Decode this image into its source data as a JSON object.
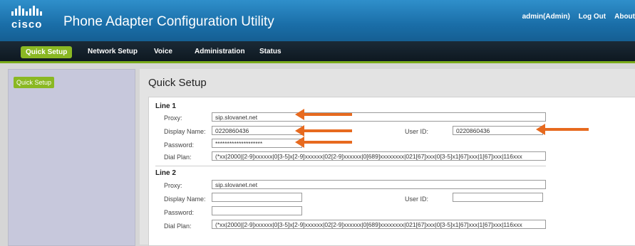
{
  "header": {
    "logo_text": "cisco",
    "title": "Phone Adapter Configuration Utility",
    "user": "admin(Admin)",
    "logout": "Log Out",
    "about": "About"
  },
  "nav": {
    "tabs": [
      {
        "label": "Quick Setup",
        "active": true
      },
      {
        "label": "Network Setup"
      },
      {
        "label": "Voice"
      },
      {
        "label": "Administration"
      },
      {
        "label": "Status"
      }
    ]
  },
  "sidebar": {
    "items": [
      {
        "label": "Quick Setup"
      }
    ]
  },
  "main": {
    "title": "Quick Setup",
    "line1": {
      "heading": "Line 1",
      "proxy_label": "Proxy:",
      "proxy_value": "sip.slovanet.net",
      "display_name_label": "Display Name:",
      "display_name_value": "0220860436",
      "user_id_label": "User ID:",
      "user_id_value": "0220860436",
      "password_label": "Password:",
      "password_value": "********************",
      "dial_plan_label": "Dial Plan:",
      "dial_plan_value": "(*xx|2000|[2-9]xxxxxx|0[3-5]x[2-9]xxxxxx|02[2-9]xxxxxx|0[689]xxxxxxxx|021[67]xxx|0[3-5]x1[67]xxx|1[67]xxx|116xxx"
    },
    "line2": {
      "heading": "Line 2",
      "proxy_label": "Proxy:",
      "proxy_value": "sip.slovanet.net",
      "display_name_label": "Display Name:",
      "display_name_value": "",
      "user_id_label": "User ID:",
      "user_id_value": "",
      "password_label": "Password:",
      "password_value": "",
      "dial_plan_label": "Dial Plan:",
      "dial_plan_value": "(*xx|2000|[2-9]xxxxxx|0[3-5]x[2-9]xxxxxx|02[2-9]xxxxxx|0[689]xxxxxxxx|021[67]xxx|0[3-5]x1[67]xxx|1[67]xxx|116xxx"
    }
  },
  "colors": {
    "header_blue": "#1a6ea8",
    "nav_dark": "#0d171f",
    "active_green": "#8ab823",
    "arrow_orange": "#e76a1f"
  }
}
